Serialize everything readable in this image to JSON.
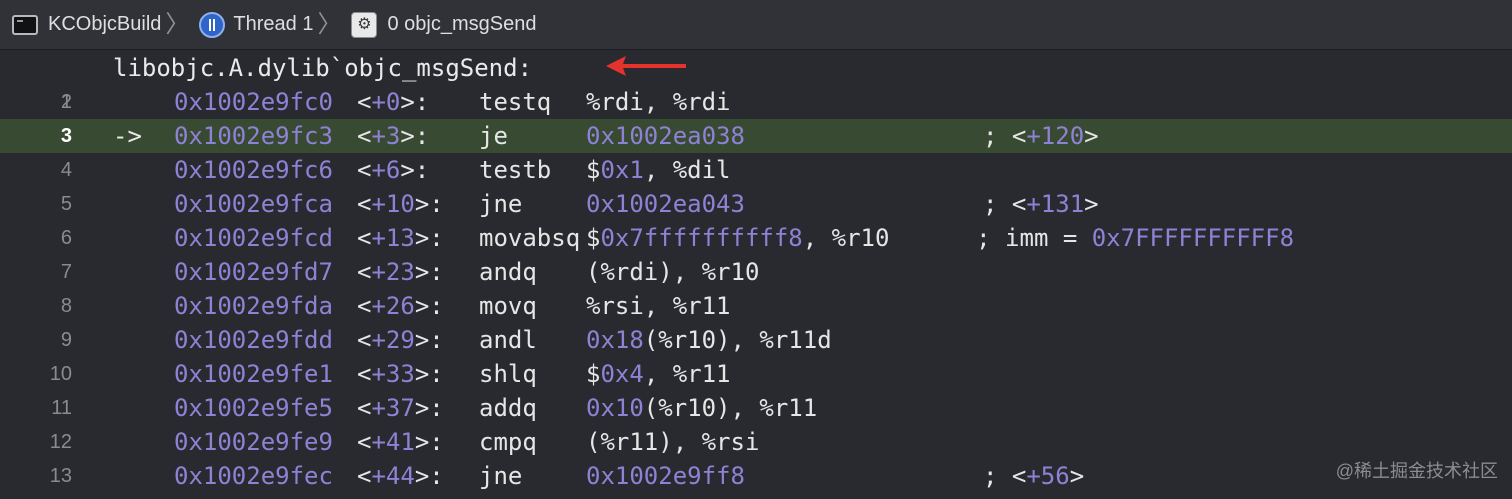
{
  "jumpbar": {
    "crumbs": [
      {
        "label": "KCObjcBuild",
        "icon": "terminal-icon"
      },
      {
        "label": "Thread 1",
        "icon": "thread-icon"
      },
      {
        "label": "0 objc_msgSend",
        "icon": "stack-frame-icon"
      }
    ],
    "separator": "〉"
  },
  "disassembly": {
    "header_line_number": "1",
    "header": "libobjc.A.dylib`objc_msgSend:",
    "current_marker": "->",
    "current_index": 1,
    "lines": [
      {
        "ln": "2",
        "addr": "0x1002e9fc0",
        "off_pre": "<",
        "off": "+0",
        "off_post": ">:",
        "mn": "testq",
        "ops": [
          {
            "t": "%rdi, %rdi",
            "n": false
          }
        ],
        "cmt": []
      },
      {
        "ln": "3",
        "addr": "0x1002e9fc3",
        "off_pre": "<",
        "off": "+3",
        "off_post": ">:",
        "mn": "je",
        "ops": [
          {
            "t": "0x1002ea038",
            "n": true
          }
        ],
        "cmt": [
          {
            "t": "; <",
            "n": false
          },
          {
            "t": "+120",
            "n": true
          },
          {
            "t": ">",
            "n": false
          }
        ]
      },
      {
        "ln": "4",
        "addr": "0x1002e9fc6",
        "off_pre": "<",
        "off": "+6",
        "off_post": ">:",
        "mn": "testb",
        "ops": [
          {
            "t": "$",
            "n": false
          },
          {
            "t": "0x1",
            "n": true
          },
          {
            "t": ", %dil",
            "n": false
          }
        ],
        "cmt": []
      },
      {
        "ln": "5",
        "addr": "0x1002e9fca",
        "off_pre": "<",
        "off": "+10",
        "off_post": ">:",
        "mn": "jne",
        "ops": [
          {
            "t": "0x1002ea043",
            "n": true
          }
        ],
        "cmt": [
          {
            "t": "; <",
            "n": false
          },
          {
            "t": "+131",
            "n": true
          },
          {
            "t": ">",
            "n": false
          }
        ]
      },
      {
        "ln": "6",
        "addr": "0x1002e9fcd",
        "off_pre": "<",
        "off": "+13",
        "off_post": ">:",
        "mn": "movabsq",
        "ops": [
          {
            "t": "$",
            "n": false
          },
          {
            "t": "0x7ffffffffff8",
            "n": true
          },
          {
            "t": ", %r10      ; imm = ",
            "n": false
          },
          {
            "t": "0x7FFFFFFFFFF8",
            "n": true
          }
        ],
        "cmt": []
      },
      {
        "ln": "7",
        "addr": "0x1002e9fd7",
        "off_pre": "<",
        "off": "+23",
        "off_post": ">:",
        "mn": "andq",
        "ops": [
          {
            "t": "(%rdi), %r10",
            "n": false
          }
        ],
        "cmt": []
      },
      {
        "ln": "8",
        "addr": "0x1002e9fda",
        "off_pre": "<",
        "off": "+26",
        "off_post": ">:",
        "mn": "movq",
        "ops": [
          {
            "t": "%rsi, %r11",
            "n": false
          }
        ],
        "cmt": []
      },
      {
        "ln": "9",
        "addr": "0x1002e9fdd",
        "off_pre": "<",
        "off": "+29",
        "off_post": ">:",
        "mn": "andl",
        "ops": [
          {
            "t": "0x18",
            "n": true
          },
          {
            "t": "(%r10), %r11d",
            "n": false
          }
        ],
        "cmt": []
      },
      {
        "ln": "10",
        "addr": "0x1002e9fe1",
        "off_pre": "<",
        "off": "+33",
        "off_post": ">:",
        "mn": "shlq",
        "ops": [
          {
            "t": "$",
            "n": false
          },
          {
            "t": "0x4",
            "n": true
          },
          {
            "t": ", %r11",
            "n": false
          }
        ],
        "cmt": []
      },
      {
        "ln": "11",
        "addr": "0x1002e9fe5",
        "off_pre": "<",
        "off": "+37",
        "off_post": ">:",
        "mn": "addq",
        "ops": [
          {
            "t": "0x10",
            "n": true
          },
          {
            "t": "(%r10), %r11",
            "n": false
          }
        ],
        "cmt": []
      },
      {
        "ln": "12",
        "addr": "0x1002e9fe9",
        "off_pre": "<",
        "off": "+41",
        "off_post": ">:",
        "mn": "cmpq",
        "ops": [
          {
            "t": "(%r11), %rsi",
            "n": false
          }
        ],
        "cmt": []
      },
      {
        "ln": "13",
        "addr": "0x1002e9fec",
        "off_pre": "<",
        "off": "+44",
        "off_post": ">:",
        "mn": "jne",
        "ops": [
          {
            "t": "0x1002e9ff8",
            "n": true
          }
        ],
        "cmt": [
          {
            "t": "; <",
            "n": false
          },
          {
            "t": "+56",
            "n": true
          },
          {
            "t": ">",
            "n": false
          }
        ]
      }
    ]
  },
  "watermark": "@稀土掘金技术社区",
  "colors": {
    "background": "#292a30",
    "current_line": "#394a33",
    "number": "#8e82d4",
    "annotation_arrow": "#e5322d"
  }
}
